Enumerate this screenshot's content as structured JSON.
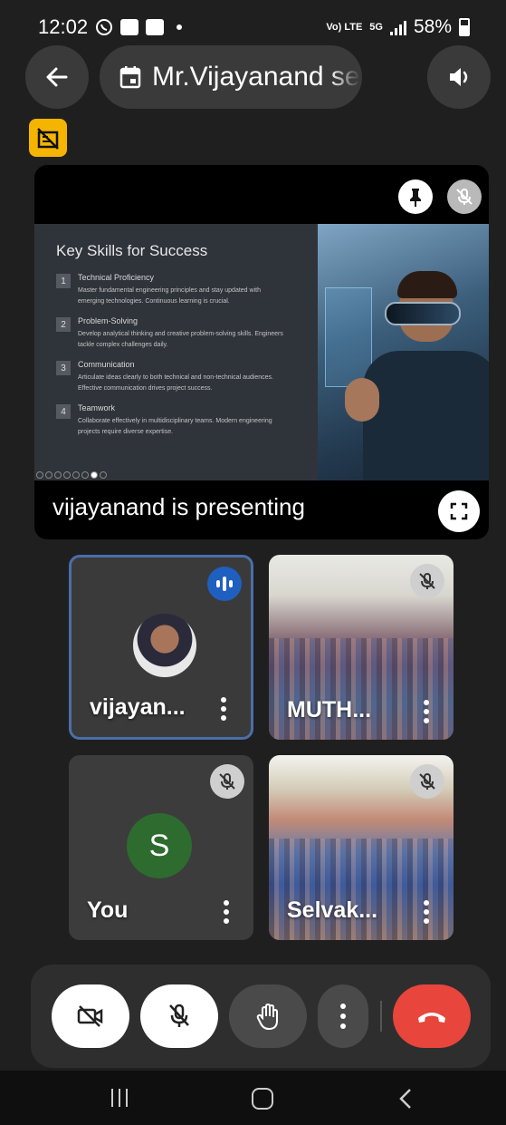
{
  "status_bar": {
    "time": "12:02",
    "network_label": "Vo) LTE",
    "five_g_label": "5G",
    "battery": "58%",
    "icons": [
      "whatsapp-icon",
      "news-icon",
      "gallery-icon"
    ]
  },
  "header": {
    "meeting_title": "Mr.Vijayanand ses",
    "back_icon": "arrow-left-icon",
    "calendar_icon": "calendar-icon",
    "speaker_icon": "speaker-icon"
  },
  "presentation": {
    "presenting_label": "vijayanand is presenting",
    "slide": {
      "title": "Key Skills for Success",
      "skills": [
        {
          "num": "1",
          "name": "Technical Proficiency",
          "desc": "Master fundamental engineering principles and stay updated with emerging technologies. Continuous learning is crucial."
        },
        {
          "num": "2",
          "name": "Problem-Solving",
          "desc": "Develop analytical thinking and creative problem-solving skills. Engineers tackle complex challenges daily."
        },
        {
          "num": "3",
          "name": "Communication",
          "desc": "Articulate ideas clearly to both technical and non-technical audiences. Effective communication drives project success."
        },
        {
          "num": "4",
          "name": "Teamwork",
          "desc": "Collaborate effectively in multidisciplinary teams. Modern engineering projects require diverse expertise."
        }
      ]
    }
  },
  "participants": [
    {
      "name": "vijayan...",
      "state": "speaking"
    },
    {
      "name": "MUTH...",
      "state": "muted"
    },
    {
      "name": "You",
      "initial": "S",
      "state": "muted"
    },
    {
      "name": "Selvak...",
      "state": "muted"
    }
  ],
  "controls": {
    "camera": "camera-off-icon",
    "mic": "mic-off-icon",
    "raise_hand": "hand-icon",
    "more": "more-vertical-icon",
    "end_call": "end-call-icon"
  },
  "colors": {
    "background": "#1f1f1f",
    "active_border": "#4a6fa8",
    "end_call": "#e8453c",
    "speaking": "#1f5fbf",
    "caption_badge": "#f5b400"
  }
}
